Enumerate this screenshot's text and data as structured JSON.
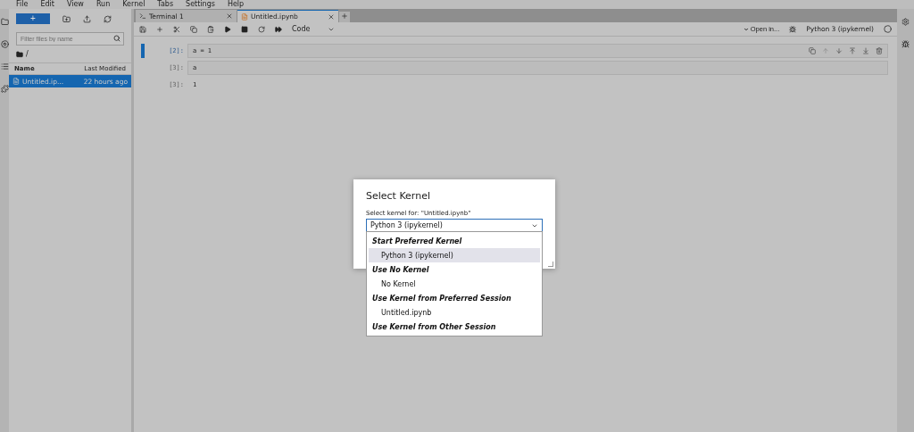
{
  "menu": [
    "File",
    "Edit",
    "View",
    "Run",
    "Kernel",
    "Tabs",
    "Settings",
    "Help"
  ],
  "sidebar": {
    "new_button": "+",
    "filter": {
      "placeholder": "Filter files by name"
    },
    "path": "/",
    "columns": [
      "Name",
      "Last Modified"
    ],
    "files": [
      {
        "name": "Untitled.ip...",
        "modified": "22 hours ago",
        "selected": true
      }
    ]
  },
  "tabs": [
    {
      "label": "Terminal 1",
      "kind": "terminal",
      "selected": false
    },
    {
      "label": "Untitled.ipynb",
      "kind": "notebook",
      "selected": true
    }
  ],
  "toolbar": {
    "cell_type": "Code",
    "open_in": "Open in...",
    "kernel": "Python 3 (ipykernel)"
  },
  "cells": [
    {
      "kind": "input",
      "prompt": "[2]:",
      "code": "a = 1",
      "active": true
    },
    {
      "kind": "input",
      "prompt": "[3]:",
      "code": "a",
      "active": false
    },
    {
      "kind": "output",
      "prompt": "[3]:",
      "code": "1",
      "active": false
    }
  ],
  "dialog": {
    "title": "Select Kernel",
    "label": "Select kernel for: \"Untitled.ipynb\"",
    "value": "Python 3 (ipykernel)",
    "options": [
      {
        "kind": "header",
        "label": "Start Preferred Kernel",
        "selected": false
      },
      {
        "kind": "item",
        "label": "Python 3 (ipykernel)",
        "selected": true
      },
      {
        "kind": "header",
        "label": "Use No Kernel",
        "selected": false
      },
      {
        "kind": "item",
        "label": "No Kernel",
        "selected": false
      },
      {
        "kind": "header",
        "label": "Use Kernel from Preferred Session",
        "selected": false
      },
      {
        "kind": "item",
        "label": "Untitled.ipynb",
        "selected": false
      },
      {
        "kind": "header",
        "label": "Use Kernel from Other Session",
        "selected": false
      }
    ]
  }
}
